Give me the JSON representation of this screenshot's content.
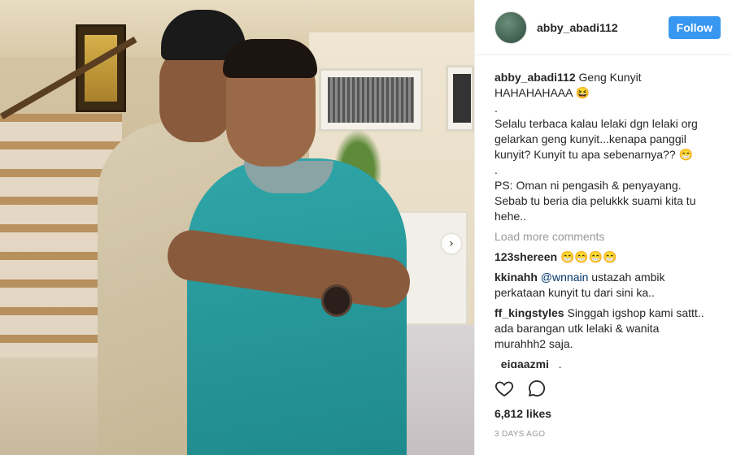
{
  "post": {
    "username": "abby_abadi112",
    "follow_label": "Follow",
    "caption_user": "abby_abadi112",
    "caption_text": "Geng Kunyit\nHAHAHAHAAA 😆\n.\nSelalu terbaca kalau lelaki dgn lelaki org gelarkan geng kunyit...kenapa panggil kunyit? Kunyit tu apa sebenarnya?? 😁\n.\nPS: Oman ni pengasih & penyayang. Sebab tu beria dia pelukkk suami kita tu hehe..",
    "load_more": "Load more comments",
    "comments": [
      {
        "user": "123shereen",
        "pre": "",
        "mention": "",
        "text": "😁😁😁😁"
      },
      {
        "user": "kkinahh",
        "pre": "",
        "mention": "@wnnain",
        "text": " ustazah ambik perkataan kunyit tu dari sini ka.."
      },
      {
        "user": "ff_kingstyles",
        "pre": "",
        "mention": "",
        "text": "Singgah igshop kami sattt.. ada barangan utk lelaki & wanita murahhh2 saja."
      },
      {
        "user": "_eiqaazmi_",
        "pre": "",
        "mention": "",
        "text": ","
      }
    ],
    "likes": "6,812 likes",
    "time": "3 DAYS AGO",
    "icons": {
      "like": "heart-icon",
      "comment": "comment-icon",
      "next": "chevron-right-icon"
    },
    "accent_color": "#3897f0"
  }
}
